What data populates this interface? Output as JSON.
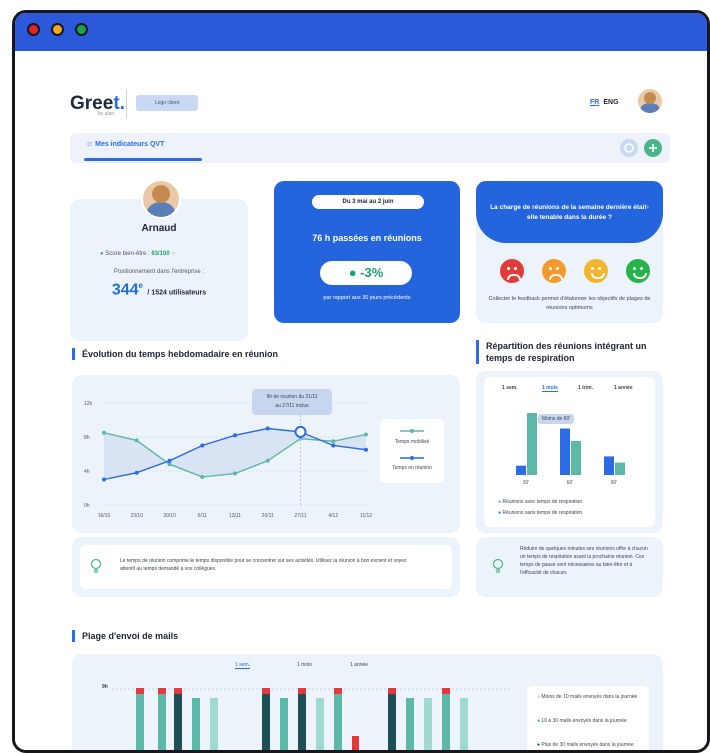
{
  "window": {
    "dots": [
      "#e02424",
      "#f5a623",
      "#1aa34a"
    ],
    "titlebar_color": "#2b59d9"
  },
  "header": {
    "logo_text": "Gree",
    "logo_accent": "t.",
    "logo_sub": "by alan",
    "logo_client": "Logo client",
    "lang_fr": "FR",
    "lang_eng": "ENG"
  },
  "tabs": {
    "active": "Mes indicateurs QVT"
  },
  "profile": {
    "name": "Arnaud",
    "score_label": "Score bien-être :",
    "score_value": "63/100",
    "position_label": "Positionnement dans l'entreprise :",
    "rank": "344",
    "rank_sup": "e",
    "rank_total": "/ 1524 utilisateurs"
  },
  "meetings": {
    "date_range": "Du 3 mai au 2 juin",
    "hours": "76 h passées en réunions",
    "change": "-3%",
    "compare": "par rapport aux 30 jours précédents"
  },
  "survey": {
    "question": "La charge de réunions de la semaine dernière était-elle tenable dans la durée ?",
    "faces": [
      "#e23b3b",
      "#f49a2c",
      "#f2b52c",
      "#26b34a"
    ],
    "feedback": "Collecter le feedback permet d'étalonner les objectifs de plages de réunions optimums"
  },
  "evolution": {
    "title": "Évolution du temps hebdomadaire en réunion",
    "tooltip_line1": "9h de réunion du 21/11",
    "tooltip_line2": "au 27/11 inclus",
    "legend_mobilized": "Temps mobilisé",
    "legend_meeting": "Temps en réunion",
    "tip": "Le temps de réunion comprime le temps disponible pour se concentrer sur ses activités. Utilisez la réunion à bon escient et soyez attentif au temps demandé à vos collègues."
  },
  "respiration": {
    "title": "Répartition des réunions intégrant un temps de respiration",
    "periods": [
      "1 sem.",
      "1 mois",
      "1 trim.",
      "1 année"
    ],
    "tooltip": "Moins de 60'",
    "legend_with": "Réunions avec temps de respiration",
    "legend_without": "Réunions sans temps de respiration",
    "tip": "Réduire de quelques minutes ses réunions offre à chacun un temps de respiration avant la prochaine réunion. Ces temps de pause sont nécessaires au bien-être et à l'efficacité de chacun."
  },
  "mails": {
    "title": "Plage d'envoi de mails",
    "periods": [
      "1 sem.",
      "1 mois",
      "1 année"
    ],
    "ytick": "9h",
    "legend": [
      "Moins de 10 mails envoyés dans la journée",
      "10 à 30 mails envoyés dans la journée",
      "Plus de 30 mails envoyés dans la journée"
    ]
  },
  "chart_data": [
    {
      "type": "line",
      "x": [
        "16/10",
        "23/10",
        "30/10",
        "6/11",
        "13/11",
        "20/11",
        "27/11",
        "4/12",
        "11/12"
      ],
      "yticks": [
        "0h",
        "4h",
        "8h",
        "12h"
      ],
      "ylim": [
        0,
        12
      ],
      "series": [
        {
          "name": "Temps mobilisé",
          "values": [
            8.5,
            7.6,
            4.8,
            3.3,
            3.7,
            5.2,
            7.8,
            7.5,
            8.3
          ]
        },
        {
          "name": "Temps en réunion",
          "values": [
            3.0,
            3.8,
            5.2,
            7.0,
            8.2,
            9.0,
            8.6,
            7.0,
            6.5
          ]
        }
      ]
    },
    {
      "type": "bar",
      "categories": [
        "30'",
        "60'",
        "90'"
      ],
      "series": [
        {
          "name": "Réunions avec temps de respiration",
          "values": [
            1.5,
            7.5,
            3.0
          ]
        },
        {
          "name": "Réunions sans temps de respiration",
          "values": [
            10.0,
            5.5,
            2.0
          ]
        }
      ]
    }
  ]
}
